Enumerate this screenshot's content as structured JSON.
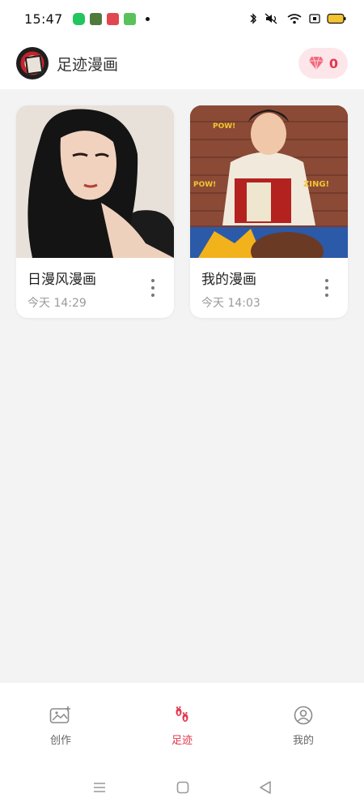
{
  "status_bar": {
    "time": "15:47",
    "notification_icons": [
      "wechat-icon",
      "card-icon",
      "video-icon",
      "calendar-icon"
    ],
    "system_icons": [
      "bluetooth-icon",
      "mute-icon",
      "wifi-icon",
      "screen-cast-icon",
      "battery-icon"
    ]
  },
  "header": {
    "title": "足迹漫画",
    "gem_count": "0"
  },
  "cards": [
    {
      "title": "日漫风漫画",
      "time": "今天 14:29"
    },
    {
      "title": "我的漫画",
      "time": "今天 14:03"
    }
  ],
  "bottom_nav": {
    "items": [
      {
        "label": "创作",
        "icon": "image-plus-icon"
      },
      {
        "label": "足迹",
        "icon": "footprints-icon"
      },
      {
        "label": "我的",
        "icon": "user-icon"
      }
    ],
    "active_index": 1
  },
  "colors": {
    "accent": "#e2384d",
    "badge_bg": "#fde6ea",
    "background": "#f3f3f3"
  }
}
